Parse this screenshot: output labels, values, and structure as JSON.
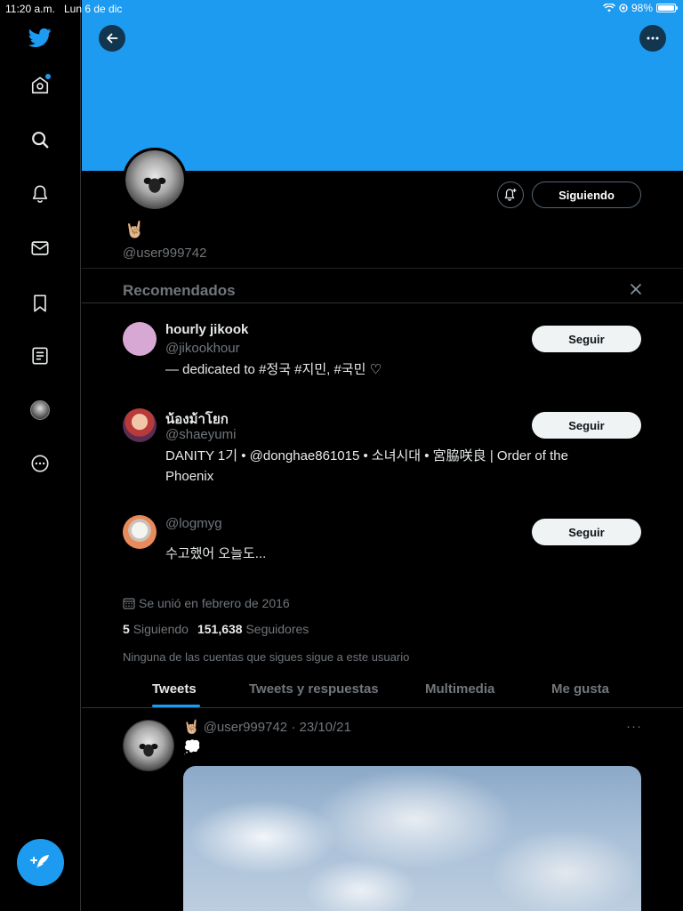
{
  "status_bar": {
    "time": "11:20 a.m.",
    "date": "Lun 6 de dic",
    "battery": "98%"
  },
  "sidebar": {
    "items": [
      {
        "icon": "twitter-logo-icon"
      },
      {
        "icon": "home-icon"
      },
      {
        "icon": "search-icon"
      },
      {
        "icon": "bell-icon"
      },
      {
        "icon": "mail-icon"
      },
      {
        "icon": "bookmark-icon"
      },
      {
        "icon": "lists-icon"
      },
      {
        "icon": "profile-avatar-icon"
      },
      {
        "icon": "more-icon"
      }
    ],
    "compose_icon": "compose-tweet-icon"
  },
  "profile": {
    "display_name": "🤘🏼",
    "handle": "@user999742",
    "following_button": "Siguiendo",
    "joined": "Se unió en febrero de 2016",
    "following_count": "5",
    "following_label": "Siguiendo",
    "followers_count": "151,638",
    "followers_label": "Seguidores",
    "no_mutual": "Ninguna de las cuentas que sigues sigue a este usuario"
  },
  "recommended": {
    "title": "Recomendados",
    "items": [
      {
        "name": "hourly jikook",
        "handle": "@jikookhour",
        "bio": "— dedicated to #정국 #지민, #국민 ♡",
        "button": "Seguir",
        "avatar_color": "#d8a8d4"
      },
      {
        "name": "น้องม้าโยก",
        "handle": "@shaeyumi",
        "bio": "DANITY 1기 • @donghae861015 • 소녀시대 • 宮脇咲良 | Order of the Phoenix",
        "button": "Seguir",
        "avatar_color": "#6b3a5a"
      },
      {
        "name": "",
        "handle": "@logmyg",
        "bio": "수고했어 오늘도...",
        "button": "Seguir",
        "avatar_color": "#e98a5c"
      }
    ]
  },
  "tabs": [
    {
      "label": "Tweets",
      "active": true
    },
    {
      "label": "Tweets y respuestas",
      "active": false
    },
    {
      "label": "Multimedia",
      "active": false
    },
    {
      "label": "Me gusta",
      "active": false
    }
  ],
  "tweet": {
    "name": "🤘🏼",
    "handle_date": "@user999742 · 23/10/21",
    "text": "💭",
    "more": "···"
  },
  "colors": {
    "accent": "#1d9bf0",
    "background": "#000000",
    "secondary_text": "#71767b"
  }
}
